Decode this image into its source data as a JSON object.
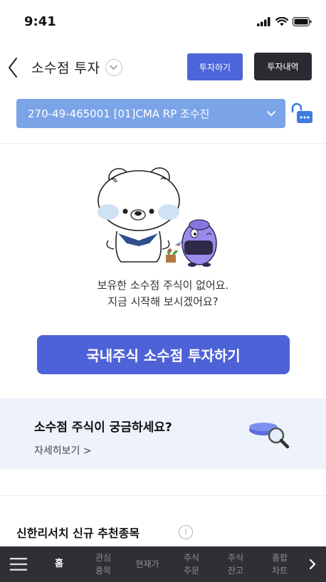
{
  "status_bar": {
    "time": "9:41"
  },
  "header": {
    "title": "소수점 투자",
    "invest_button": "투자하기",
    "history_button": "투자내역"
  },
  "account": {
    "selected": "270-49-465001 [01]CMA RP 조수진"
  },
  "empty_state": {
    "line1": "보유한 소수점 주식이 없어요.",
    "line2": "지금 시작해 보시겠어요?"
  },
  "cta": {
    "label": "국내주식 소수점 투자하기"
  },
  "banner": {
    "title": "소수점 주식이 궁금하세요?",
    "link": "자세히보기 >"
  },
  "section": {
    "title": "신한리서치 신규 추천종목",
    "info_icon_label": "!"
  },
  "bottom_nav": {
    "items": [
      {
        "label": "홈",
        "active": true
      },
      {
        "label": "관심\n종목",
        "active": false
      },
      {
        "label": "현재가",
        "active": false
      },
      {
        "label": "주식\n주문",
        "active": false
      },
      {
        "label": "주식\n잔고",
        "active": false
      },
      {
        "label": "종합\n차트",
        "active": false
      }
    ]
  },
  "colors": {
    "primary": "#4e62d8",
    "account_bar": "#7ba4e8",
    "nav_bg": "#2f3034",
    "banner_bg": "#eef2fb"
  },
  "icons": [
    "signal-icon",
    "wifi-icon",
    "battery-icon",
    "back-icon",
    "chevron-down-icon",
    "lock-icon",
    "magnifier-icon",
    "menu-icon",
    "chevron-right-icon",
    "info-icon"
  ]
}
